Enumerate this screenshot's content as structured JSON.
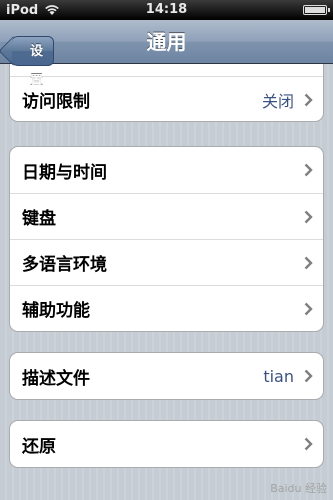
{
  "status_bar": {
    "carrier": "iPod",
    "time": "14:18"
  },
  "nav": {
    "back_label": "设置",
    "title": "通用"
  },
  "groups": [
    {
      "rows": [
        {
          "label": "访问限制",
          "value": "关闭"
        }
      ]
    },
    {
      "rows": [
        {
          "label": "日期与时间",
          "value": ""
        },
        {
          "label": "键盘",
          "value": ""
        },
        {
          "label": "多语言环境",
          "value": ""
        },
        {
          "label": "辅助功能",
          "value": ""
        }
      ]
    },
    {
      "rows": [
        {
          "label": "描述文件",
          "value": "tian"
        }
      ]
    },
    {
      "rows": [
        {
          "label": "还原",
          "value": ""
        }
      ]
    }
  ],
  "watermark": "Baidu 经验",
  "colors": {
    "nav_bar": "#6d84a2",
    "value_text": "#3b5380",
    "background": "#c5ccd4"
  },
  "battery_level": 1.0
}
